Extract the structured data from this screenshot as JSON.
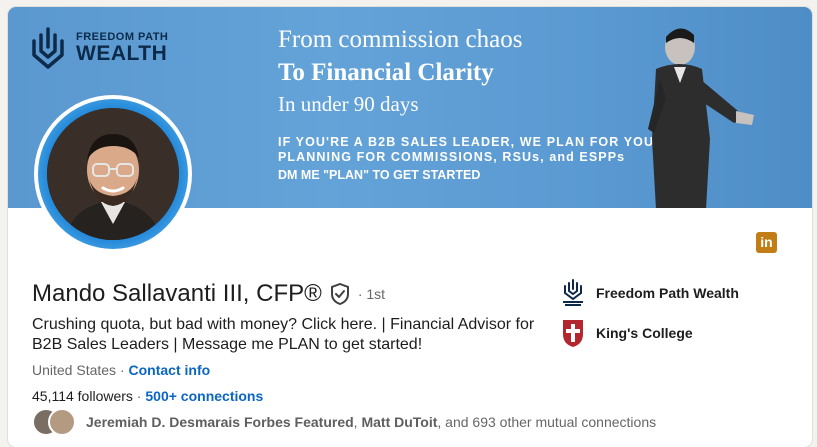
{
  "banner": {
    "logo": {
      "line1": "FREEDOM PATH",
      "line2": "WEALTH"
    },
    "headline1": "From commission chaos",
    "headline2": "To Financial Clarity",
    "headline3": "In under 90 days",
    "caps1": "IF YOU'RE A B2B SALES LEADER, WE PLAN FOR YOU",
    "caps2": "PLANNING FOR COMMISSIONS, RSUs, and ESPPs",
    "cta": "DM ME \"PLAN\" TO GET STARTED"
  },
  "profile": {
    "name": "Mando Sallavanti III, CFP®",
    "degree": "· 1st",
    "headline": "Crushing quota, but bad with money? Click here. | Financial Advisor for B2B Sales Leaders | Message me PLAN to get started!",
    "location": "United States",
    "location_sep": " · ",
    "contact_info": "Contact info",
    "followers": "45,114 followers",
    "followers_sep": " · ",
    "connections": "500+ connections",
    "mutual": {
      "name1": "Jeremiah D. Desmarais Forbes Featured",
      "sep": ", ",
      "name2": "Matt DuToit",
      "rest": ", and 693 other mutual connections"
    }
  },
  "linkedin_badge": "in",
  "sidebar": {
    "company": "Freedom Path Wealth",
    "school": "King's College"
  },
  "colors": {
    "link": "#0a66c2",
    "banner": "#5b9ad2",
    "linkedin_badge": "#c37d16",
    "kings_red": "#b3262e"
  },
  "icons": [
    "verified-shield-icon",
    "linkedin-icon",
    "freedom-path-logo",
    "kings-college-logo"
  ]
}
